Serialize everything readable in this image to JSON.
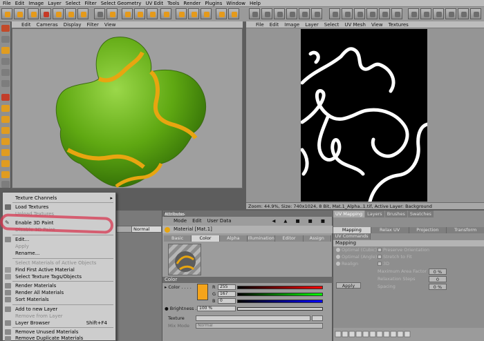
{
  "menubar": [
    "File",
    "Edit",
    "Image",
    "Layer",
    "Select",
    "Filter",
    "Select Geometry",
    "UV Edit",
    "Tools",
    "Render",
    "Plugins",
    "Window",
    "Help"
  ],
  "viewport": {
    "menu": [
      "Edit",
      "Cameras",
      "Display",
      "Filter",
      "View"
    ]
  },
  "texture_view": {
    "menu": [
      "File",
      "Edit",
      "Image",
      "Layer",
      "Select",
      "UV Mesh",
      "View",
      "Textures"
    ],
    "status": "Zoom: 44.9%, Size: 740x1024, 8 Bit, Mat.1_Alpha..1.tif, Active Layer: Background"
  },
  "context_menu": {
    "items": [
      {
        "label": "Texture Channels",
        "submenu": true,
        "disabled": false
      },
      {
        "label": "Load Textures",
        "disabled": false
      },
      {
        "label": "Unload Textures",
        "disabled": true
      },
      {
        "label": "Enable 3D Paint",
        "disabled": false,
        "checked": true
      },
      {
        "label": "Disable 3D Paint",
        "disabled": true
      },
      {
        "label": "Edit...",
        "disabled": false
      },
      {
        "label": "Apply",
        "disabled": true
      },
      {
        "label": "Rename...",
        "disabled": false
      },
      {
        "label": "Select Materials of Active Objects",
        "disabled": true
      },
      {
        "label": "Find First Active Material",
        "disabled": false
      },
      {
        "label": "Select Texture Tags/Objects",
        "disabled": false
      },
      {
        "label": "Render Materials",
        "disabled": false
      },
      {
        "label": "Render All Materials",
        "disabled": false
      },
      {
        "label": "Sort Materials",
        "disabled": false
      },
      {
        "label": "Add to new Layer",
        "disabled": false
      },
      {
        "label": "Remove from Layer",
        "disabled": true
      },
      {
        "label": "Layer Browser",
        "shortcut": "Shift+F4",
        "disabled": false
      },
      {
        "label": "Remove Unused Materials",
        "disabled": false
      },
      {
        "label": "Remove Duplicate Materials",
        "disabled": false
      }
    ]
  },
  "layer_panel": {
    "blend_mode": "Normal"
  },
  "attributes": {
    "title": "Attributes",
    "mode_menu": [
      "Mode",
      "Edit",
      "User Data"
    ],
    "material_name": "Material [Mat.1]",
    "tabs": [
      "Basic",
      "Color",
      "Alpha",
      "Illumination",
      "Editor",
      "Assign"
    ],
    "active_tab": "Color",
    "section": "Color",
    "color_label": "Color",
    "color_hex": "#f5a41a",
    "r_label": "R",
    "r_value": "255",
    "g_label": "G",
    "g_value": "167",
    "b_label": "B",
    "b_value": "0",
    "brightness_label": "Brightness",
    "brightness_value": "100 %",
    "texture_label": "Texture",
    "mix_mode_label": "Mix Mode",
    "mix_mode_value": "Normal"
  },
  "uv_panel": {
    "tabs": [
      "UV Mapping",
      "Layers",
      "Brushes",
      "Swatches"
    ],
    "sub_tabs": [
      "Mapping",
      "Relax UV",
      "Projection",
      "Transform"
    ],
    "sub_tabs2": [
      "UV Commands"
    ],
    "section": "Mapping",
    "options_left": [
      "Optimal (Cubic)",
      "Optimal (Angle)",
      "Realign"
    ],
    "options_right": [
      "Preserve Orientation",
      "Stretch to Fit",
      "3D"
    ],
    "fields": [
      {
        "label": "Maximum Area Factor",
        "value": "0 %"
      },
      {
        "label": "Relaxation Steps",
        "value": "0"
      },
      {
        "label": "Spacing",
        "value": "0 %"
      }
    ],
    "apply_label": "Apply"
  },
  "colors": {
    "object_green": "#6fb81d",
    "object_stripe": "#e8a510",
    "texture_bg": "#000000",
    "texture_stroke": "#ffffff"
  }
}
